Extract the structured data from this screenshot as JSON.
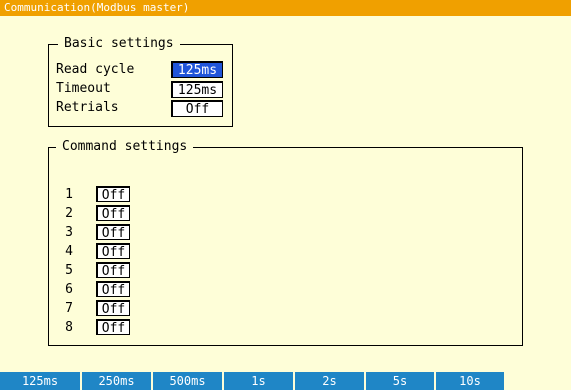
{
  "titlebar": {
    "title": "Communication(Modbus master)"
  },
  "basic_settings": {
    "title": "Basic settings",
    "rows": [
      {
        "label": "Read cycle",
        "value": "125ms",
        "selected": true
      },
      {
        "label": "Timeout",
        "value": "125ms",
        "selected": false
      },
      {
        "label": "Retrials",
        "value": "Off",
        "selected": false
      }
    ]
  },
  "command_settings": {
    "title": "Command settings",
    "commands": [
      {
        "num": "1",
        "value": "Off"
      },
      {
        "num": "2",
        "value": "Off"
      },
      {
        "num": "3",
        "value": "Off"
      },
      {
        "num": "4",
        "value": "Off"
      },
      {
        "num": "5",
        "value": "Off"
      },
      {
        "num": "6",
        "value": "Off"
      },
      {
        "num": "7",
        "value": "Off"
      },
      {
        "num": "8",
        "value": "Off"
      }
    ]
  },
  "softkeys": [
    "125ms",
    "250ms",
    "500ms",
    "1s",
    "2s",
    "5s",
    "10s"
  ],
  "colors": {
    "titlebar": "#f0a000",
    "background": "#fefed8",
    "selected": "#2055d8",
    "softkey": "#1f86c6"
  }
}
